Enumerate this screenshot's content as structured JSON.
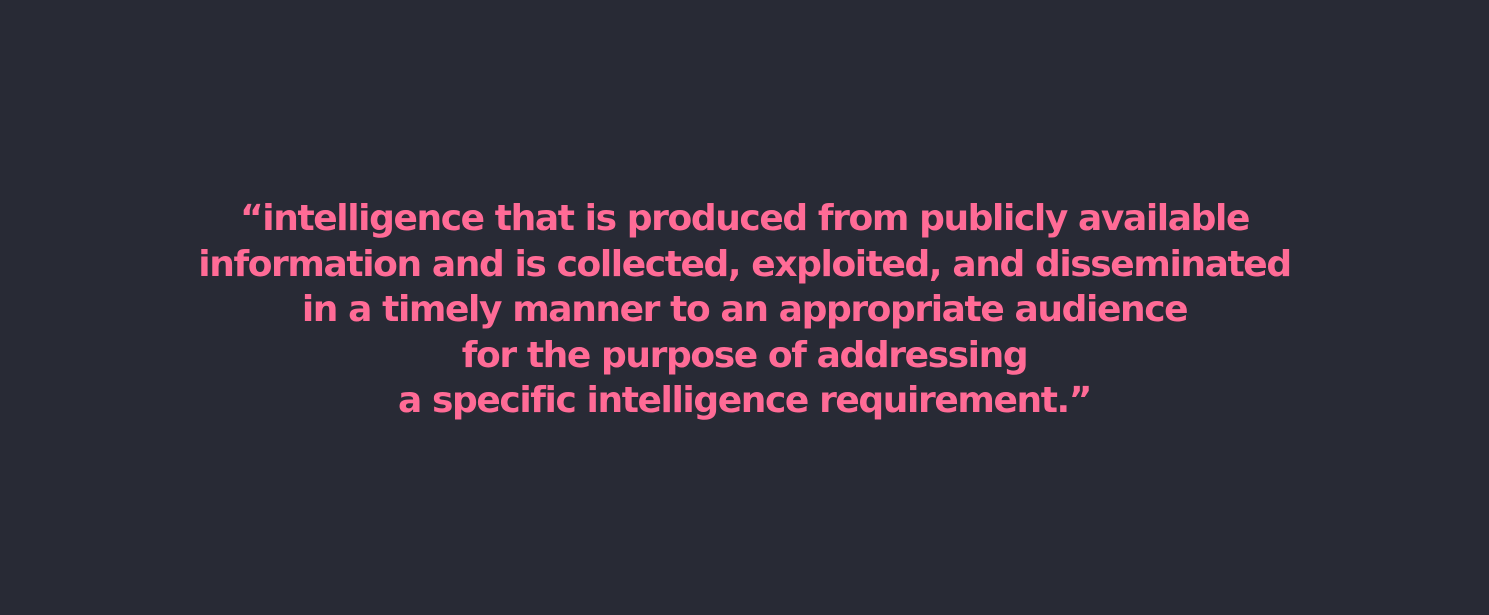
{
  "quote": {
    "lines": [
      "“intelligence that is produced from publicly available",
      "information and is collected, exploited, and disseminated",
      "in a timely manner to an appropriate audience",
      "for the purpose of addressing",
      "a specific intelligence requirement.”"
    ]
  },
  "colors": {
    "background": "#282a35",
    "text": "#ff6b96"
  }
}
